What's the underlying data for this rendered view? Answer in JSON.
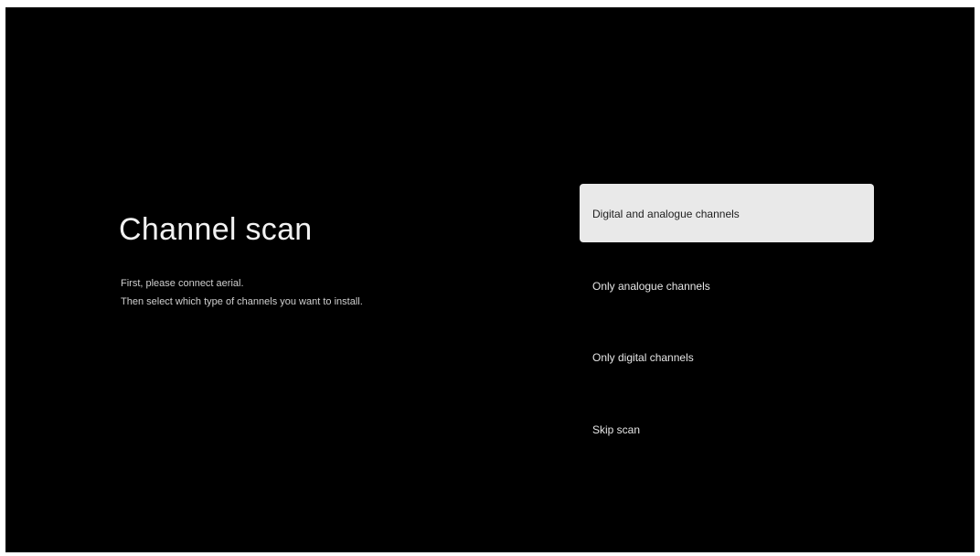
{
  "page": {
    "title": "Channel scan",
    "description_lines": [
      "First, please connect aerial.",
      "Then select which type of channels you want to install."
    ]
  },
  "menu": {
    "selected_index": 0,
    "items": [
      {
        "label": "Digital and analogue channels"
      },
      {
        "label": "Only analogue channels"
      },
      {
        "label": "Only digital channels"
      },
      {
        "label": "Skip scan"
      }
    ]
  },
  "colors": {
    "background": "#000000",
    "selected_item_bg": "#e9e9e9",
    "selected_item_text": "#1e1e1e",
    "item_text": "#e6e6e6"
  }
}
